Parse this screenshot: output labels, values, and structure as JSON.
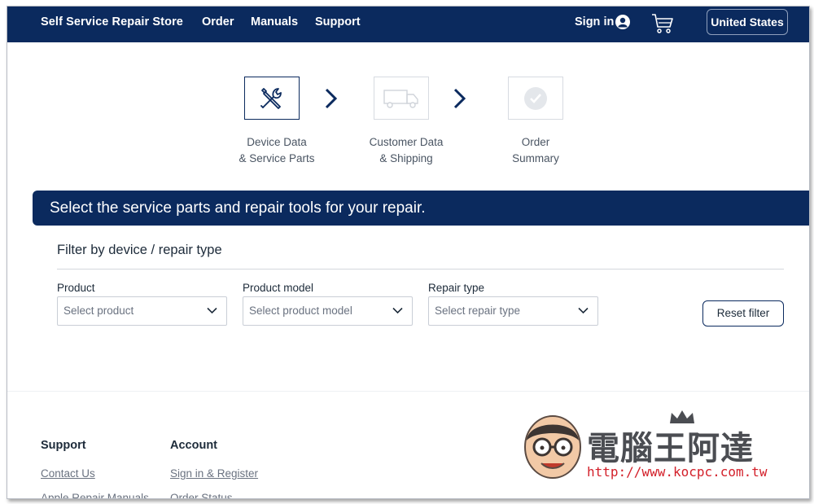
{
  "header": {
    "brand": "Self Service Repair Store",
    "nav": [
      "Order",
      "Manuals",
      "Support"
    ],
    "sign_in": "Sign in",
    "country": "United States"
  },
  "steps": [
    {
      "line1": "Device Data",
      "line2": "& Service Parts",
      "icon": "tools-icon",
      "active": true
    },
    {
      "line1": "Customer Data",
      "line2": "& Shipping",
      "icon": "truck-icon",
      "active": false
    },
    {
      "line1": "Order",
      "line2": "Summary",
      "icon": "check-circle-icon",
      "active": false
    }
  ],
  "banner": "Select the service parts and repair tools for your repair.",
  "filter": {
    "title": "Filter by device / repair type",
    "fields": [
      {
        "label": "Product",
        "placeholder": "Select product"
      },
      {
        "label": "Product model",
        "placeholder": "Select product model"
      },
      {
        "label": "Repair type",
        "placeholder": "Select repair type"
      }
    ],
    "reset": "Reset filter"
  },
  "footer": {
    "support": {
      "title": "Support",
      "links": [
        "Contact Us",
        "Apple Repair Manuals"
      ]
    },
    "account": {
      "title": "Account",
      "links": [
        "Sign in & Register",
        "Order Status"
      ]
    }
  },
  "watermark": {
    "title": "電腦王阿達",
    "url": "http://www.kocpc.com.tw"
  },
  "colors": {
    "brand_navy": "#0b2a5e",
    "link_gray": "#6a7280",
    "watermark_red": "#d3202a"
  }
}
